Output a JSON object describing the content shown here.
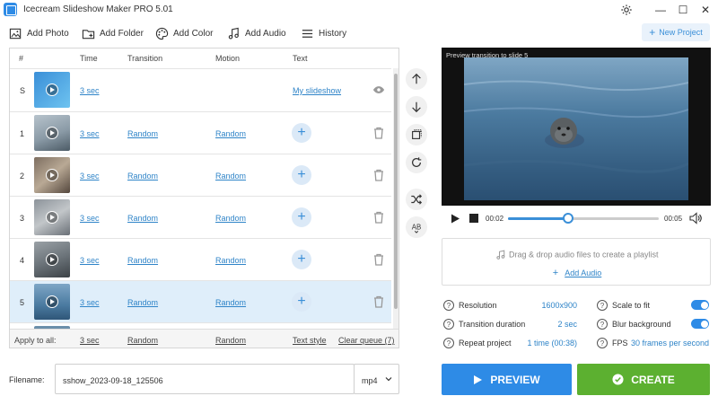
{
  "app": {
    "title": "Icecream Slideshow Maker PRO 5.01"
  },
  "toolbar": {
    "add_photo": "Add Photo",
    "add_folder": "Add Folder",
    "add_color": "Add Color",
    "add_audio": "Add Audio",
    "history": "History",
    "new_project": "New Project"
  },
  "table": {
    "headers": {
      "num": "#",
      "time": "Time",
      "transition": "Transition",
      "motion": "Motion",
      "text": "Text"
    },
    "rows": [
      {
        "num": "S",
        "time": "3 sec",
        "transition": "",
        "motion": "",
        "text": "My slideshow",
        "kind": "title"
      },
      {
        "num": "1",
        "time": "3 sec",
        "transition": "Random",
        "motion": "Random",
        "text": "",
        "kind": "slide"
      },
      {
        "num": "2",
        "time": "3 sec",
        "transition": "Random",
        "motion": "Random",
        "text": "",
        "kind": "slide"
      },
      {
        "num": "3",
        "time": "3 sec",
        "transition": "Random",
        "motion": "Random",
        "text": "",
        "kind": "slide"
      },
      {
        "num": "4",
        "time": "3 sec",
        "transition": "Random",
        "motion": "Random",
        "text": "",
        "kind": "slide"
      },
      {
        "num": "5",
        "time": "3 sec",
        "transition": "Random",
        "motion": "Random",
        "text": "",
        "kind": "slide",
        "selected": true
      }
    ],
    "footer": {
      "apply_label": "Apply to all:",
      "time": "3 sec",
      "transition": "Random",
      "motion": "Random",
      "text_style": "Text style",
      "clear_queue": "Clear queue (7)"
    }
  },
  "preview": {
    "caption": "Preview transition to slide 5",
    "time_current": "00:02",
    "time_total": "00:05",
    "progress": 0.4
  },
  "audio": {
    "hint": "Drag & drop audio files to create a playlist",
    "add": "Add Audio"
  },
  "settings": {
    "resolution_label": "Resolution",
    "resolution_value": "1600x900",
    "transition_duration_label": "Transition duration",
    "transition_duration_value": "2 sec",
    "repeat_label": "Repeat project",
    "repeat_value": "1 time (00:38)",
    "scale_label": "Scale to fit",
    "scale_on": true,
    "blur_label": "Blur background",
    "blur_on": true,
    "fps_label": "FPS",
    "fps_value": "30 frames per second"
  },
  "output": {
    "filename_label": "Filename:",
    "filename_value": "sshow_2023-09-18_125506",
    "format": "mp4"
  },
  "buttons": {
    "preview": "PREVIEW",
    "create": "CREATE"
  },
  "colors": {
    "accent": "#2e8be6",
    "create": "#5cb030",
    "link": "#2f84c8"
  }
}
